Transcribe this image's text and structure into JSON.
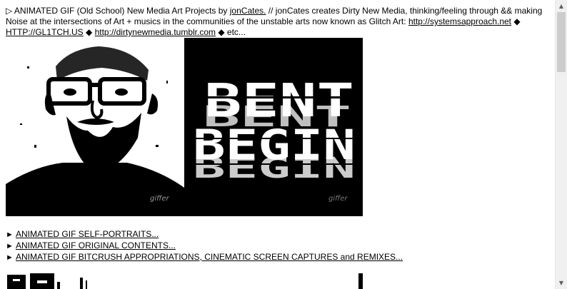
{
  "intro": {
    "lead": "▷ ANIMATED GIF (Old School) New Media Art Projects by ",
    "author_link": "jonCates.",
    "description": " // jonCates creates Dirty New Media, thinking/feeling through && making Noise at the intersections of Art + musics in the communities of the unstable arts now known as Glitch Art: ",
    "link1": "http://systemsapproach.net",
    "sep1": " ◆ ",
    "link2": "HTTP://GL1TCH.US",
    "sep2": " ◆ ",
    "link3": "http://dirtynewmedia.tumblr.com",
    "tail": " ◆ etc..."
  },
  "gif": {
    "text_line1": "BENT",
    "text_line2": "BEGIN",
    "watermark_left": "giffer",
    "watermark_right": "giffer"
  },
  "links": [
    {
      "bullet": "► ",
      "label": "ANIMATED GIF SELF-PORTRAITS..."
    },
    {
      "bullet": "► ",
      "label": "ANIMATED GIF ORIGINAL CONTENTS..."
    },
    {
      "bullet": "► ",
      "label": "ANIMATED GIF BITCRUSH APPROPRIATIONS, CINEMATIC SCREEN CAPTURES and REMIXES..."
    }
  ],
  "icons": {
    "scroll_up": "triangle-up-icon",
    "scroll_down": "triangle-down-icon"
  }
}
